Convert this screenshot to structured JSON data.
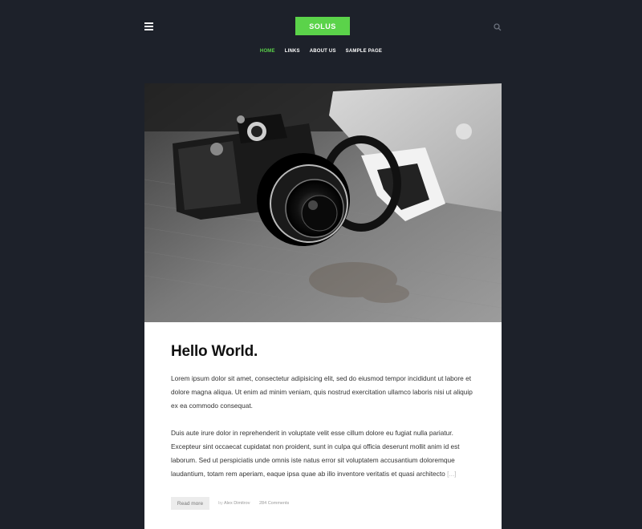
{
  "header": {
    "logo": "SOLUS",
    "nav": [
      {
        "label": "HOME",
        "active": true
      },
      {
        "label": "LINKS",
        "active": false
      },
      {
        "label": "ABOUT US",
        "active": false
      },
      {
        "label": "SAMPLE PAGE",
        "active": false
      }
    ]
  },
  "post": {
    "image_alt": "camera-photo",
    "title": "Hello World.",
    "paragraph1": "Lorem ipsum dolor sit amet, consectetur adipisicing elit, sed do eiusmod tempor incididunt ut labore et dolore magna aliqua. Ut enim ad minim veniam, quis nostrud exercitation ullamco laboris nisi ut aliquip ex ea commodo consequat.",
    "paragraph2": "Duis aute irure dolor in reprehenderit in voluptate velit esse cillum dolore eu fugiat nulla pariatur. Excepteur sint occaecat cupidatat non proident, sunt in culpa qui officia deserunt mollit anim id est laborum. Sed ut perspiciatis unde omnis iste natus error sit voluptatem accusantium doloremque laudantium, totam rem aperiam, eaque ipsa quae ab illo inventore veritatis et quasi architecto",
    "ellipsis": "[...]",
    "read_more": "Read more",
    "by_prefix": "by",
    "author": "Alex Dimitrov",
    "comments": "284 Comments"
  },
  "colors": {
    "background": "#1d212a",
    "accent": "#5bd34a",
    "card": "#ffffff"
  }
}
